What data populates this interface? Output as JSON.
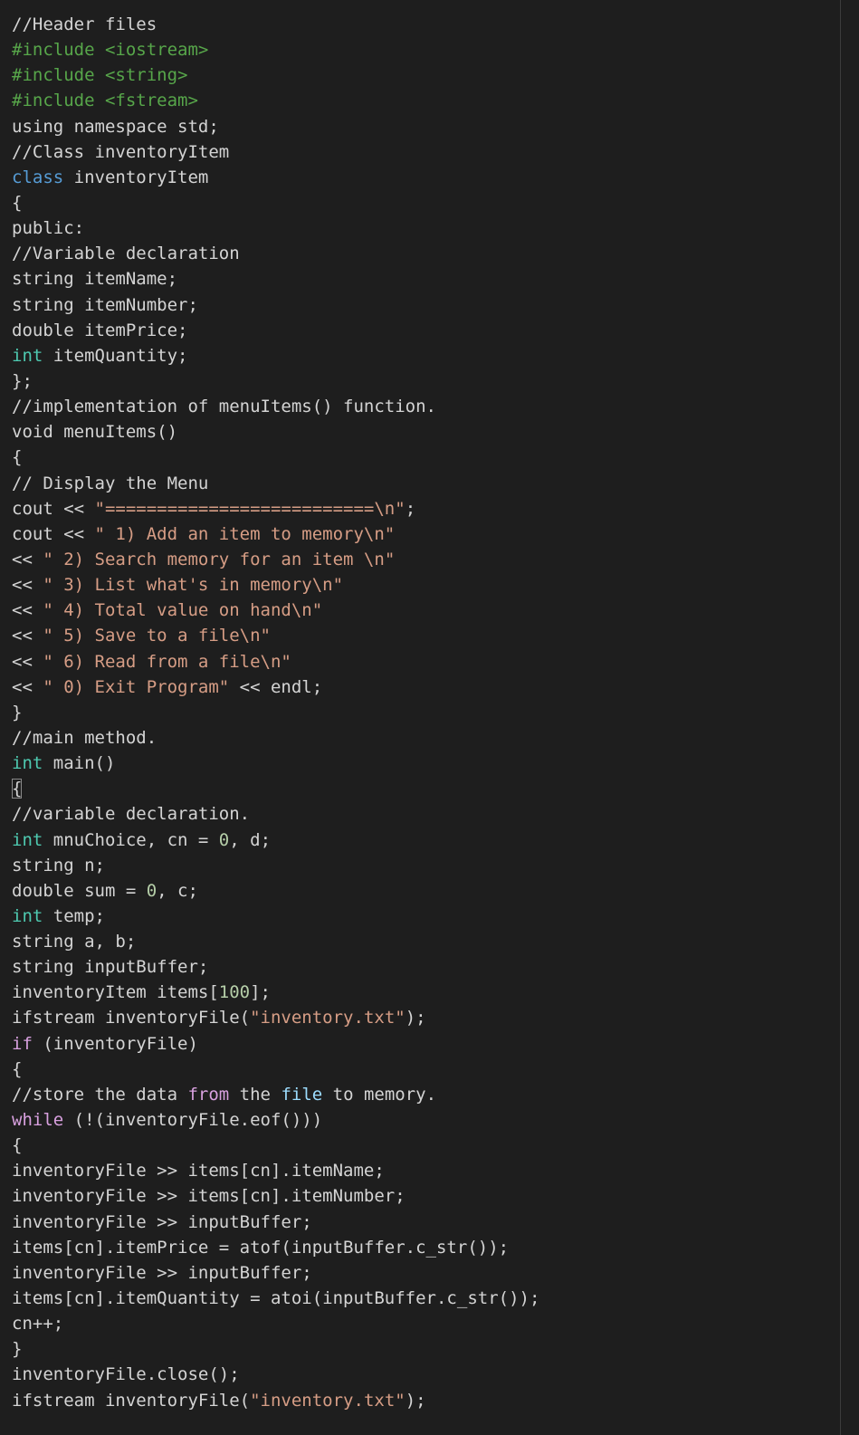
{
  "lines": [
    [
      {
        "t": "//Header files",
        "c": "comment"
      }
    ],
    [
      {
        "t": "#include <iostream>",
        "c": "preproc"
      }
    ],
    [
      {
        "t": "#include <string>",
        "c": "preproc"
      }
    ],
    [
      {
        "t": "#include <fstream>",
        "c": "preproc"
      }
    ],
    [
      {
        "t": "using namespace std;",
        "c": "default"
      }
    ],
    [
      {
        "t": "//Class inventoryItem",
        "c": "comment"
      }
    ],
    [
      {
        "t": "class",
        "c": "keyword"
      },
      {
        "t": " inventoryItem",
        "c": "default"
      }
    ],
    [
      {
        "t": "{",
        "c": "default"
      }
    ],
    [
      {
        "t": "public:",
        "c": "default"
      }
    ],
    [
      {
        "t": "//Variable declaration",
        "c": "comment"
      }
    ],
    [
      {
        "t": "string itemName;",
        "c": "default"
      }
    ],
    [
      {
        "t": "string itemNumber;",
        "c": "default"
      }
    ],
    [
      {
        "t": "double itemPrice;",
        "c": "default"
      }
    ],
    [
      {
        "t": "int",
        "c": "type"
      },
      {
        "t": " itemQuantity;",
        "c": "default"
      }
    ],
    [
      {
        "t": "};",
        "c": "default"
      }
    ],
    [
      {
        "t": "//implementation of menuItems() function.",
        "c": "comment"
      }
    ],
    [
      {
        "t": "void menuItems()",
        "c": "default"
      }
    ],
    [
      {
        "t": "{",
        "c": "default"
      }
    ],
    [
      {
        "t": "// Display the Menu",
        "c": "comment"
      }
    ],
    [
      {
        "t": "cout << ",
        "c": "default"
      },
      {
        "t": "\"==========================\\n\"",
        "c": "string"
      },
      {
        "t": ";",
        "c": "default"
      }
    ],
    [
      {
        "t": "cout << ",
        "c": "default"
      },
      {
        "t": "\" 1) Add an item to memory\\n\"",
        "c": "string"
      }
    ],
    [
      {
        "t": "<< ",
        "c": "default"
      },
      {
        "t": "\" 2) Search memory for an item \\n\"",
        "c": "string"
      }
    ],
    [
      {
        "t": "<< ",
        "c": "default"
      },
      {
        "t": "\" 3) List what's in memory\\n\"",
        "c": "string"
      }
    ],
    [
      {
        "t": "<< ",
        "c": "default"
      },
      {
        "t": "\" 4) Total value on hand\\n\"",
        "c": "string"
      }
    ],
    [
      {
        "t": "<< ",
        "c": "default"
      },
      {
        "t": "\" 5) Save to a file\\n\"",
        "c": "string"
      }
    ],
    [
      {
        "t": "<< ",
        "c": "default"
      },
      {
        "t": "\" 6) Read from a file\\n\"",
        "c": "string"
      }
    ],
    [
      {
        "t": "<< ",
        "c": "default"
      },
      {
        "t": "\" 0) Exit Program\"",
        "c": "string"
      },
      {
        "t": " << endl;",
        "c": "default"
      }
    ],
    [
      {
        "t": "}",
        "c": "default"
      }
    ],
    [
      {
        "t": "//main method.",
        "c": "comment"
      }
    ],
    [
      {
        "t": "int",
        "c": "type"
      },
      {
        "t": " main()",
        "c": "default"
      }
    ],
    [
      {
        "t": "{",
        "c": "bracket-hl"
      }
    ],
    [
      {
        "t": "//variable declaration.",
        "c": "comment"
      }
    ],
    [
      {
        "t": "int",
        "c": "type"
      },
      {
        "t": " mnuChoice, cn = ",
        "c": "default"
      },
      {
        "t": "0",
        "c": "number"
      },
      {
        "t": ", d;",
        "c": "default"
      }
    ],
    [
      {
        "t": "string n;",
        "c": "default"
      }
    ],
    [
      {
        "t": "double sum = ",
        "c": "default"
      },
      {
        "t": "0",
        "c": "number"
      },
      {
        "t": ", c;",
        "c": "default"
      }
    ],
    [
      {
        "t": "int",
        "c": "type"
      },
      {
        "t": " temp;",
        "c": "default"
      }
    ],
    [
      {
        "t": "string a, b;",
        "c": "default"
      }
    ],
    [
      {
        "t": "string inputBuffer;",
        "c": "default"
      }
    ],
    [
      {
        "t": "inventoryItem items[",
        "c": "default"
      },
      {
        "t": "100",
        "c": "number"
      },
      {
        "t": "];",
        "c": "default"
      }
    ],
    [
      {
        "t": "ifstream inventoryFile(",
        "c": "default"
      },
      {
        "t": "\"inventory.txt\"",
        "c": "string"
      },
      {
        "t": ");",
        "c": "default"
      }
    ],
    [
      {
        "t": "if",
        "c": "control"
      },
      {
        "t": " (inventoryFile)",
        "c": "default"
      }
    ],
    [
      {
        "t": "{",
        "c": "default"
      }
    ],
    [
      {
        "t": "//store the data ",
        "c": "comment"
      },
      {
        "t": "from",
        "c": "control"
      },
      {
        "t": " the ",
        "c": "comment"
      },
      {
        "t": "file",
        "c": "ident"
      },
      {
        "t": " to memory.",
        "c": "comment"
      }
    ],
    [
      {
        "t": "while",
        "c": "control"
      },
      {
        "t": " (!(inventoryFile.eof()))",
        "c": "default"
      }
    ],
    [
      {
        "t": "{",
        "c": "default"
      }
    ],
    [
      {
        "t": "inventoryFile >> items[cn].itemName;",
        "c": "default"
      }
    ],
    [
      {
        "t": "inventoryFile >> items[cn].itemNumber;",
        "c": "default"
      }
    ],
    [
      {
        "t": "inventoryFile >> inputBuffer;",
        "c": "default"
      }
    ],
    [
      {
        "t": "items[cn].itemPrice = atof(inputBuffer.c_str());",
        "c": "default"
      }
    ],
    [
      {
        "t": "inventoryFile >> inputBuffer;",
        "c": "default"
      }
    ],
    [
      {
        "t": "items[cn].itemQuantity = atoi(inputBuffer.c_str());",
        "c": "default"
      }
    ],
    [
      {
        "t": "cn++;",
        "c": "default"
      }
    ],
    [
      {
        "t": "}",
        "c": "default"
      }
    ],
    [
      {
        "t": "inventoryFile.close();",
        "c": "default"
      }
    ],
    [
      {
        "t": "ifstream inventoryFile(",
        "c": "default"
      },
      {
        "t": "\"inventory.txt\"",
        "c": "string"
      },
      {
        "t": ");",
        "c": "default"
      }
    ]
  ]
}
